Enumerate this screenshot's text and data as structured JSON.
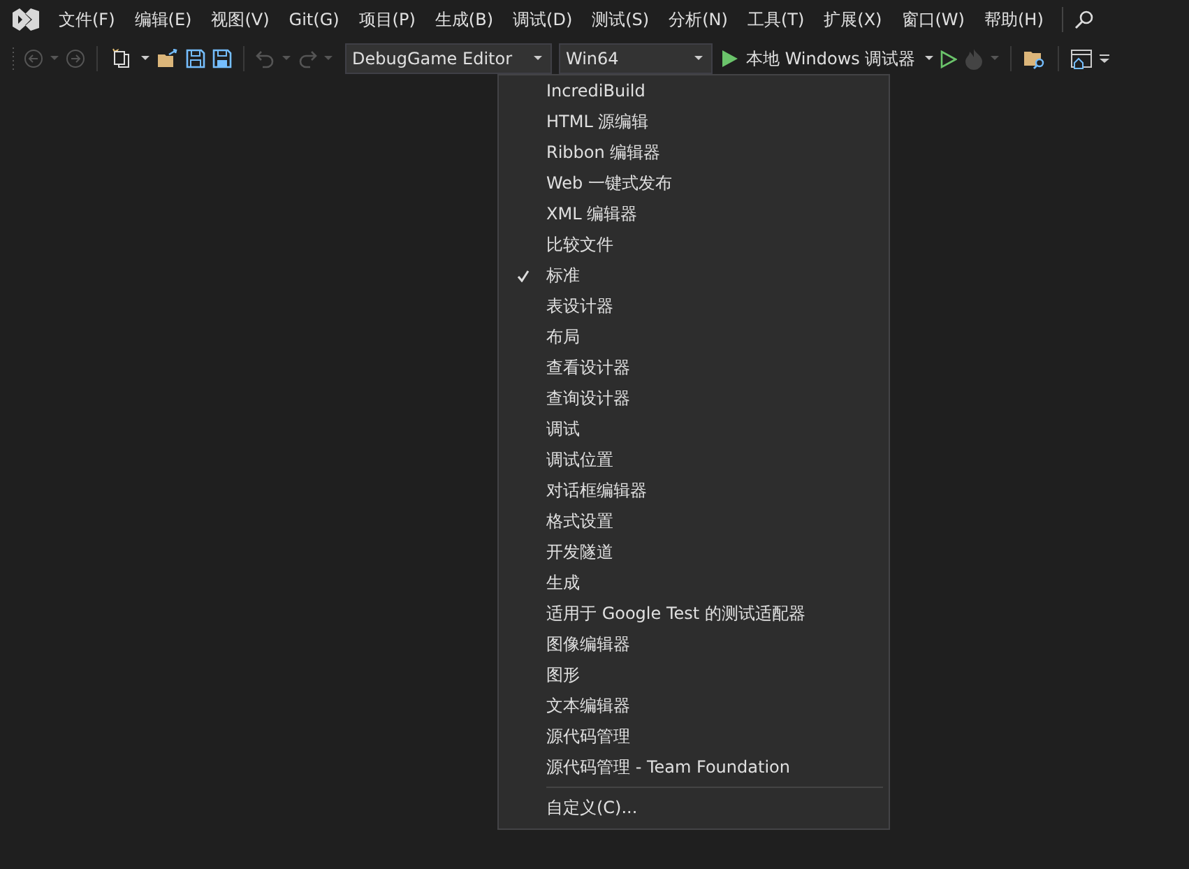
{
  "menu_bar": [
    "文件(F)",
    "编辑(E)",
    "视图(V)",
    "Git(G)",
    "项目(P)",
    "生成(B)",
    "调试(D)",
    "测试(S)",
    "分析(N)",
    "工具(T)",
    "扩展(X)",
    "窗口(W)",
    "帮助(H)"
  ],
  "toolbar": {
    "configuration": "DebugGame Editor",
    "platform": "Win64",
    "start_debugger": "本地 Windows 调试器"
  },
  "context_menu": {
    "items": [
      {
        "label": "IncrediBuild",
        "checked": false
      },
      {
        "label": "HTML 源编辑",
        "checked": false
      },
      {
        "label": "Ribbon 编辑器",
        "checked": false
      },
      {
        "label": "Web 一键式发布",
        "checked": false
      },
      {
        "label": "XML 编辑器",
        "checked": false
      },
      {
        "label": "比较文件",
        "checked": false
      },
      {
        "label": "标准",
        "checked": true
      },
      {
        "label": "表设计器",
        "checked": false
      },
      {
        "label": "布局",
        "checked": false
      },
      {
        "label": "查看设计器",
        "checked": false
      },
      {
        "label": "查询设计器",
        "checked": false
      },
      {
        "label": "调试",
        "checked": false
      },
      {
        "label": "调试位置",
        "checked": false
      },
      {
        "label": "对话框编辑器",
        "checked": false
      },
      {
        "label": "格式设置",
        "checked": false
      },
      {
        "label": "开发隧道",
        "checked": false
      },
      {
        "label": "生成",
        "checked": false
      },
      {
        "label": "适用于 Google Test 的测试适配器",
        "checked": false
      },
      {
        "label": "图像编辑器",
        "checked": false
      },
      {
        "label": "图形",
        "checked": false
      },
      {
        "label": "文本编辑器",
        "checked": false
      },
      {
        "label": "源代码管理",
        "checked": false
      },
      {
        "label": "源代码管理 - Team Foundation",
        "checked": false
      }
    ],
    "customize": "自定义(C)..."
  }
}
